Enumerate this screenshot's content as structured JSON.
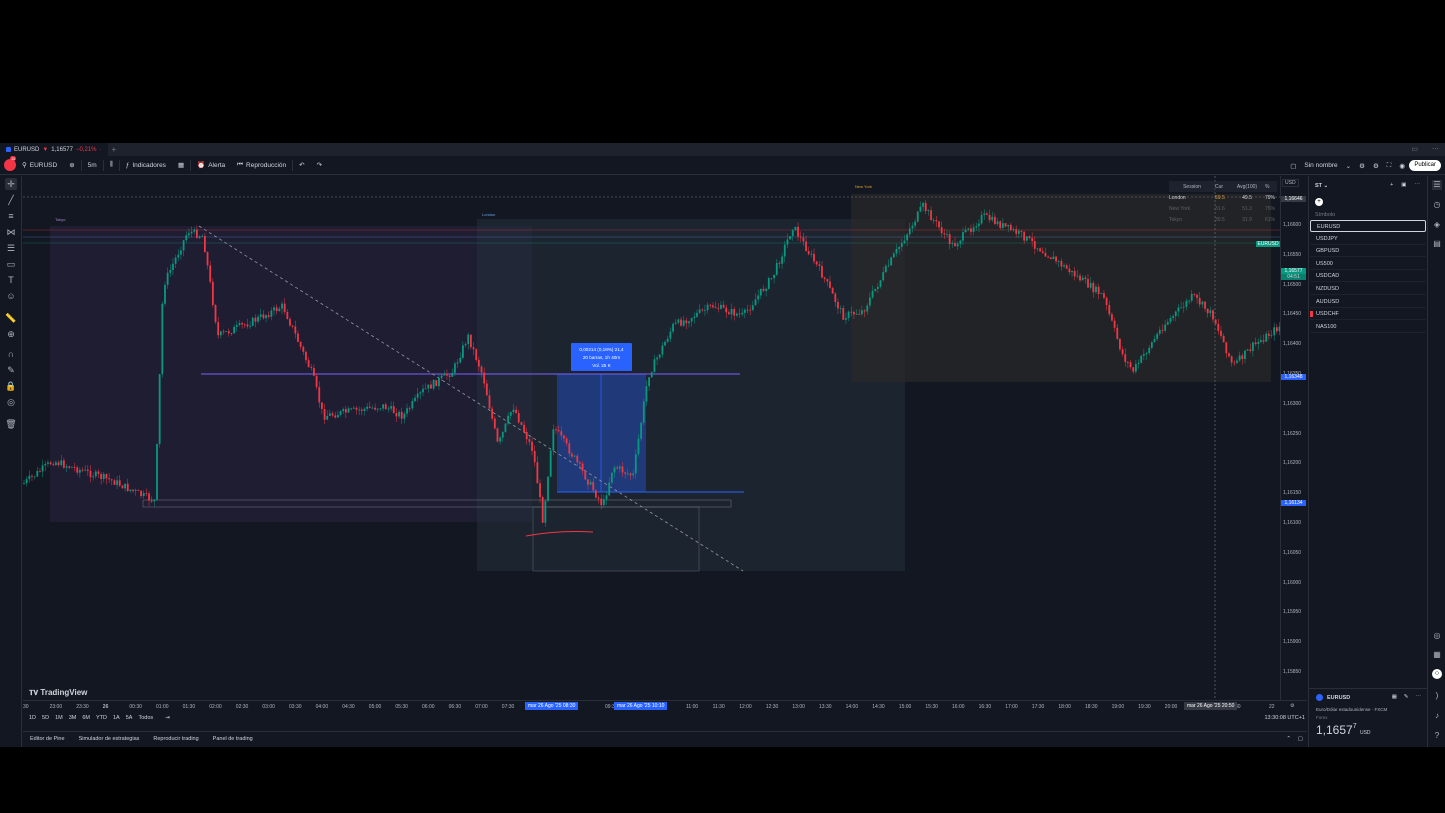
{
  "tab": {
    "symbol": "EURUSD",
    "arrow": "▼",
    "price": "1,16577",
    "change": "−0,21%",
    "suffix": "·"
  },
  "toolbar": {
    "symbol": "EURUSD",
    "interval": "5m",
    "indicators": "Indicadores",
    "alert": "Alerta",
    "replay": "Reproducción",
    "layout_name": "Sin nombre",
    "publish": "Publicar",
    "avatar_badge": "11"
  },
  "chart": {
    "zones": [
      {
        "label": "Tokyo"
      },
      {
        "label": "London"
      },
      {
        "label": "New York"
      }
    ],
    "measure": {
      "line1": "0,00214 (0,18%) 21,4",
      "line2": "20 barras, 1h 40m",
      "line3": "Vol. 25 K"
    },
    "logo_text": "TradingView",
    "session_table": {
      "headers": [
        "Session",
        "Cur",
        "Avg(100)",
        "%"
      ],
      "rows": [
        {
          "name": "London",
          "cur": "59.5",
          "avg": "49.5",
          "pct": "79%"
        },
        {
          "name": "New York",
          "cur": "31.6",
          "avg": "51.3",
          "pct": "75%"
        },
        {
          "name": "Tokyo",
          "cur": "30.5",
          "avg": "31.9",
          "pct": "61%"
        }
      ]
    }
  },
  "price_axis": {
    "currency": "USD",
    "labels": [
      "1,16600",
      "1,16550",
      "1,16500",
      "1,16450",
      "1,16400",
      "1,16350",
      "1,16300",
      "1,16250",
      "1,16200",
      "1,16150",
      "1,16100",
      "1,16050",
      "1,16000",
      "1,15950",
      "1,15900",
      "1,15850"
    ],
    "tags": [
      {
        "text": "1,16646",
        "color": "#363a45"
      },
      {
        "text": "1,16577",
        "color": "#089981"
      },
      {
        "text": "1,16348",
        "color": "#2962ff"
      },
      {
        "text": "1,16134",
        "color": "#2962ff"
      }
    ],
    "symbol_tag": "EURUSD",
    "countdown": "04:51"
  },
  "time_axis": {
    "labels": [
      "30",
      "23:00",
      "23:30",
      "26",
      "00:30",
      "01:00",
      "01:30",
      "02:00",
      "02:30",
      "03:00",
      "03:30",
      "04:00",
      "04:30",
      "05:00",
      "05:30",
      "06:00",
      "06:30",
      "07:00",
      "07:30",
      "09:30",
      "11:00",
      "11:30",
      "12:00",
      "12:30",
      "13:00",
      "13:30",
      "14:00",
      "14:30",
      "15:00",
      "15:30",
      "16:00",
      "16:30",
      "17:00",
      "17:30",
      "18:00",
      "18:30",
      "19:00",
      "19:30",
      "20:00",
      "21:30",
      "22"
    ],
    "tag1": "mar 26 Ago '25  08:30",
    "tag2": "mar 26 Ago '25  10:10",
    "tag3": "mar 26 Ago '25  20:50"
  },
  "ranges": [
    "1D",
    "5D",
    "1M",
    "3M",
    "6M",
    "YTD",
    "1A",
    "5A",
    "Todos"
  ],
  "clock": "13:30:08 UTC+1",
  "bottom_tabs": [
    "Editor de Pine",
    "Simulador de estrategias",
    "Reproducir trading",
    "Panel de trading"
  ],
  "watchlist": {
    "title": "ST",
    "column_header": "Símbolo",
    "items": [
      "EURUSD",
      "USDJPY",
      "GBPUSD",
      "US500",
      "USDCAD",
      "NZDUSD",
      "AUDUSD",
      "USDCHF",
      "NAS100"
    ],
    "detail": {
      "symbol": "EURUSD",
      "name": "Euro/Dólar estadounidense",
      "exchange": "FXCM",
      "type": "Forex",
      "price_main": "1,1657",
      "price_small": "7",
      "currency": "USD"
    }
  },
  "colors": {
    "up": "#089981",
    "down": "#f23645",
    "accent": "#2962ff",
    "bg": "#131722"
  }
}
